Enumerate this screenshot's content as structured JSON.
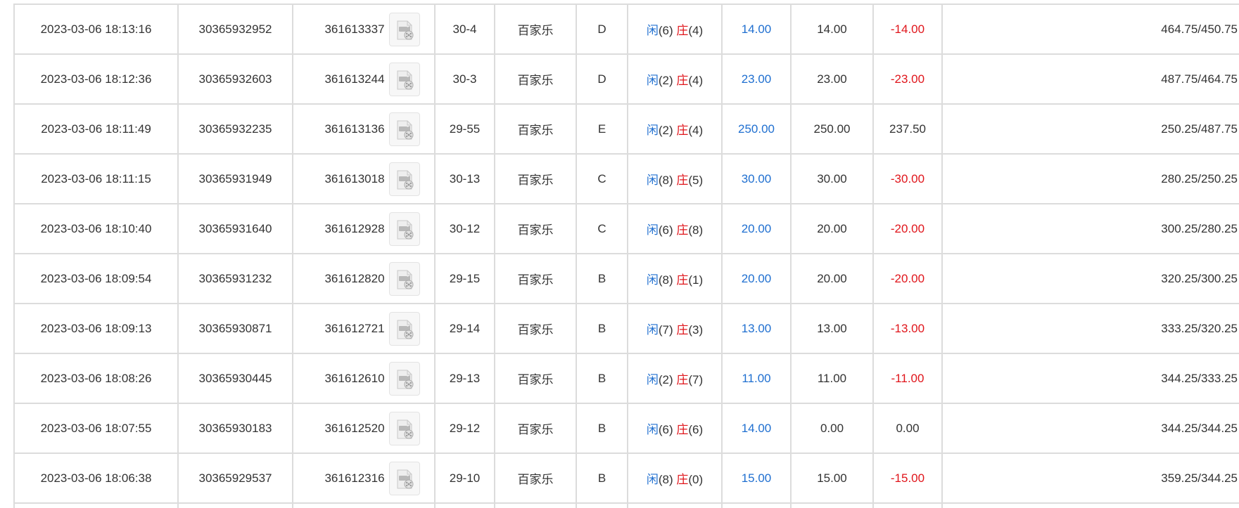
{
  "table": {
    "rows": [
      {
        "time": "2023-03-06 18:13:16",
        "order": "30365932952",
        "round": "361613337",
        "table_no": "30-4",
        "game": "百家乐",
        "bet_type": "D",
        "player_label": "闲",
        "player_score": "(6)",
        "banker_label": "庄",
        "banker_score": "(4)",
        "bet": "14.00",
        "valid": "14.00",
        "win_loss": "-14.00",
        "balance": "464.75/450.75"
      },
      {
        "time": "2023-03-06 18:12:36",
        "order": "30365932603",
        "round": "361613244",
        "table_no": "30-3",
        "game": "百家乐",
        "bet_type": "D",
        "player_label": "闲",
        "player_score": "(2)",
        "banker_label": "庄",
        "banker_score": "(4)",
        "bet": "23.00",
        "valid": "23.00",
        "win_loss": "-23.00",
        "balance": "487.75/464.75"
      },
      {
        "time": "2023-03-06 18:11:49",
        "order": "30365932235",
        "round": "361613136",
        "table_no": "29-55",
        "game": "百家乐",
        "bet_type": "E",
        "player_label": "闲",
        "player_score": "(2)",
        "banker_label": "庄",
        "banker_score": "(4)",
        "bet": "250.00",
        "valid": "250.00",
        "win_loss": "237.50",
        "balance": "250.25/487.75"
      },
      {
        "time": "2023-03-06 18:11:15",
        "order": "30365931949",
        "round": "361613018",
        "table_no": "30-13",
        "game": "百家乐",
        "bet_type": "C",
        "player_label": "闲",
        "player_score": "(8)",
        "banker_label": "庄",
        "banker_score": "(5)",
        "bet": "30.00",
        "valid": "30.00",
        "win_loss": "-30.00",
        "balance": "280.25/250.25"
      },
      {
        "time": "2023-03-06 18:10:40",
        "order": "30365931640",
        "round": "361612928",
        "table_no": "30-12",
        "game": "百家乐",
        "bet_type": "C",
        "player_label": "闲",
        "player_score": "(6)",
        "banker_label": "庄",
        "banker_score": "(8)",
        "bet": "20.00",
        "valid": "20.00",
        "win_loss": "-20.00",
        "balance": "300.25/280.25"
      },
      {
        "time": "2023-03-06 18:09:54",
        "order": "30365931232",
        "round": "361612820",
        "table_no": "29-15",
        "game": "百家乐",
        "bet_type": "B",
        "player_label": "闲",
        "player_score": "(8)",
        "banker_label": "庄",
        "banker_score": "(1)",
        "bet": "20.00",
        "valid": "20.00",
        "win_loss": "-20.00",
        "balance": "320.25/300.25"
      },
      {
        "time": "2023-03-06 18:09:13",
        "order": "30365930871",
        "round": "361612721",
        "table_no": "29-14",
        "game": "百家乐",
        "bet_type": "B",
        "player_label": "闲",
        "player_score": "(7)",
        "banker_label": "庄",
        "banker_score": "(3)",
        "bet": "13.00",
        "valid": "13.00",
        "win_loss": "-13.00",
        "balance": "333.25/320.25"
      },
      {
        "time": "2023-03-06 18:08:26",
        "order": "30365930445",
        "round": "361612610",
        "table_no": "29-13",
        "game": "百家乐",
        "bet_type": "B",
        "player_label": "闲",
        "player_score": "(2)",
        "banker_label": "庄",
        "banker_score": "(7)",
        "bet": "11.00",
        "valid": "11.00",
        "win_loss": "-11.00",
        "balance": "344.25/333.25"
      },
      {
        "time": "2023-03-06 18:07:55",
        "order": "30365930183",
        "round": "361612520",
        "table_no": "29-12",
        "game": "百家乐",
        "bet_type": "B",
        "player_label": "闲",
        "player_score": "(6)",
        "banker_label": "庄",
        "banker_score": "(6)",
        "bet": "14.00",
        "valid": "0.00",
        "win_loss": "0.00",
        "balance": "344.25/344.25"
      },
      {
        "time": "2023-03-06 18:06:38",
        "order": "30365929537",
        "round": "361612316",
        "table_no": "29-10",
        "game": "百家乐",
        "bet_type": "B",
        "player_label": "闲",
        "player_score": "(8)",
        "banker_label": "庄",
        "banker_score": "(0)",
        "bet": "15.00",
        "valid": "15.00",
        "win_loss": "-15.00",
        "balance": "359.25/344.25"
      }
    ]
  },
  "icons": {
    "replay": "video-replay-icon"
  },
  "colors": {
    "player": "#1f6fd0",
    "banker": "#e0151b",
    "bet": "#1f6fd0",
    "loss": "#e0151b",
    "border": "#dcdcdc"
  }
}
